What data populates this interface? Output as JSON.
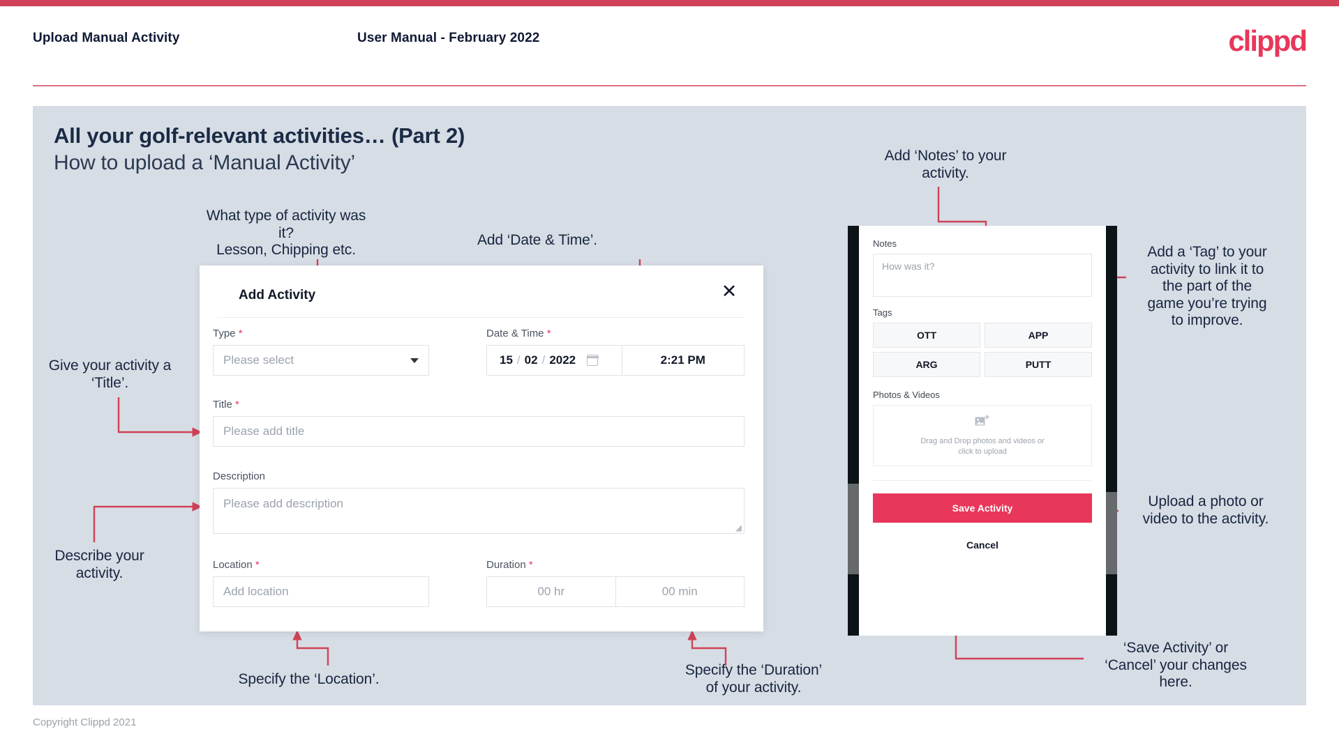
{
  "header": {
    "left_title": "Upload Manual Activity",
    "center_title": "User Manual - February 2022",
    "logo": "clippd"
  },
  "slide": {
    "title": "All your golf-relevant activities… (Part 2)",
    "subtitle": "How to upload a ‘Manual Activity’",
    "copyright": "Copyright Clippd 2021"
  },
  "annotations": {
    "type": "What type of activity was it?\nLesson, Chipping etc.",
    "datetime": "Add ‘Date & Time’.",
    "title": "Give your activity a\n‘Title’.",
    "description": "Describe your\nactivity.",
    "location": "Specify the ‘Location’.",
    "duration": "Specify the ‘Duration’\nof your activity.",
    "notes": "Add ‘Notes’ to your\nactivity.",
    "tags": "Add a ‘Tag’ to your\nactivity to link it to\nthe part of the\ngame you’re trying\nto improve.",
    "upload": "Upload a photo or\nvideo to the activity.",
    "save": "‘Save Activity’ or\n‘Cancel’ your changes\nhere."
  },
  "dialog": {
    "title": "Add Activity",
    "close_icon": "close-icon",
    "fields": {
      "type": {
        "label": "Type",
        "required": "*",
        "placeholder": "Please select",
        "icon": "chevron-down-icon"
      },
      "datetime": {
        "label": "Date & Time",
        "required": "*",
        "day": "15",
        "month": "02",
        "year": "2022",
        "separator": "/",
        "calendar_icon": "calendar-icon",
        "time": "2:21 PM"
      },
      "title": {
        "label": "Title",
        "required": "*",
        "placeholder": "Please add title"
      },
      "description": {
        "label": "Description",
        "required": "",
        "placeholder": "Please add description"
      },
      "location": {
        "label": "Location",
        "required": "*",
        "placeholder": "Add location"
      },
      "duration": {
        "label": "Duration",
        "required": "*",
        "hours_placeholder": "00 hr",
        "minutes_placeholder": "00 min"
      }
    }
  },
  "phone": {
    "notes": {
      "label": "Notes",
      "placeholder": "How was it?"
    },
    "tags": {
      "label": "Tags",
      "items": [
        "OTT",
        "APP",
        "ARG",
        "PUTT"
      ]
    },
    "photos": {
      "label": "Photos & Videos",
      "icon": "add-image-icon",
      "drop_text_line1": "Drag and Drop photos and videos or",
      "drop_text_line2": "click to upload"
    },
    "save_label": "Save Activity",
    "cancel_label": "Cancel"
  },
  "colors": {
    "brand_pink": "#e8375a",
    "accent_rule": "#cf4257",
    "slide_bg": "#d7dde5",
    "text_dark": "#17253f"
  }
}
